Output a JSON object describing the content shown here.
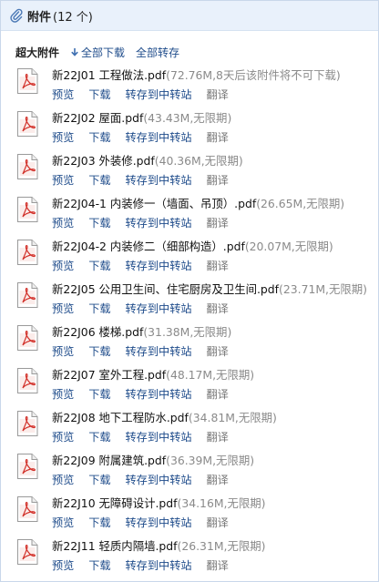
{
  "header": {
    "title": "附件",
    "count": "(12 个)"
  },
  "toolbar": {
    "title": "超大附件",
    "download_all": "全部下载",
    "save_all": "全部转存"
  },
  "action_labels": {
    "preview": "预览",
    "download": "下载",
    "transfer": "转存到中转站",
    "translate": "翻译"
  },
  "files": [
    {
      "name": "新22J01 工程做法.pdf",
      "meta": "(72.76M,8天后该附件将不可下载)"
    },
    {
      "name": "新22J02 屋面.pdf",
      "meta": "(43.43M,无限期)"
    },
    {
      "name": "新22J03 外装修.pdf",
      "meta": "(40.36M,无限期)"
    },
    {
      "name": "新22J04-1 内装修一（墙面、吊顶）.pdf",
      "meta": "(26.65M,无限期)"
    },
    {
      "name": "新22J04-2 内装修二（细部构造）.pdf",
      "meta": "(20.07M,无限期)"
    },
    {
      "name": "新22J05 公用卫生间、住宅厨房及卫生间.pdf",
      "meta": "(23.71M,无限期)"
    },
    {
      "name": "新22J06 楼梯.pdf",
      "meta": "(31.38M,无限期)"
    },
    {
      "name": "新22J07 室外工程.pdf",
      "meta": "(48.17M,无限期)"
    },
    {
      "name": "新22J08 地下工程防水.pdf",
      "meta": "(34.81M,无限期)"
    },
    {
      "name": "新22J09 附属建筑.pdf",
      "meta": "(36.39M,无限期)"
    },
    {
      "name": "新22J10 无障碍设计.pdf",
      "meta": "(34.16M,无限期)"
    },
    {
      "name": "新22J11 轻质内隔墙.pdf",
      "meta": "(26.31M,无限期)"
    }
  ],
  "icons": {
    "attachment": "paperclip-icon",
    "download": "download-arrow-icon",
    "file": "pdf-file-icon"
  },
  "colors": {
    "link": "#1f4c8b",
    "meta": "#8a8a8a",
    "header_bg": "#e9f1fb",
    "pdf_red": "#d2312a"
  }
}
